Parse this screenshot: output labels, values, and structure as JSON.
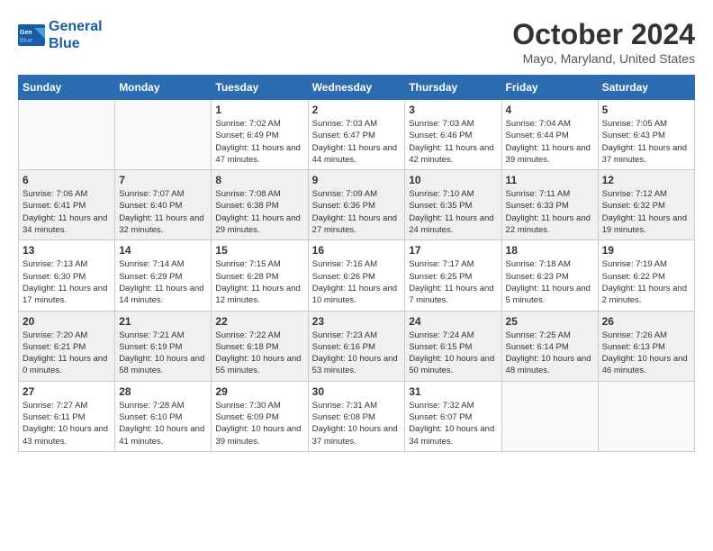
{
  "header": {
    "logo_line1": "General",
    "logo_line2": "Blue",
    "month_title": "October 2024",
    "location": "Mayo, Maryland, United States"
  },
  "weekdays": [
    "Sunday",
    "Monday",
    "Tuesday",
    "Wednesday",
    "Thursday",
    "Friday",
    "Saturday"
  ],
  "weeks": [
    [
      {
        "day": "",
        "info": ""
      },
      {
        "day": "",
        "info": ""
      },
      {
        "day": "1",
        "info": "Sunrise: 7:02 AM\nSunset: 6:49 PM\nDaylight: 11 hours and 47 minutes."
      },
      {
        "day": "2",
        "info": "Sunrise: 7:03 AM\nSunset: 6:47 PM\nDaylight: 11 hours and 44 minutes."
      },
      {
        "day": "3",
        "info": "Sunrise: 7:03 AM\nSunset: 6:46 PM\nDaylight: 11 hours and 42 minutes."
      },
      {
        "day": "4",
        "info": "Sunrise: 7:04 AM\nSunset: 6:44 PM\nDaylight: 11 hours and 39 minutes."
      },
      {
        "day": "5",
        "info": "Sunrise: 7:05 AM\nSunset: 6:43 PM\nDaylight: 11 hours and 37 minutes."
      }
    ],
    [
      {
        "day": "6",
        "info": "Sunrise: 7:06 AM\nSunset: 6:41 PM\nDaylight: 11 hours and 34 minutes."
      },
      {
        "day": "7",
        "info": "Sunrise: 7:07 AM\nSunset: 6:40 PM\nDaylight: 11 hours and 32 minutes."
      },
      {
        "day": "8",
        "info": "Sunrise: 7:08 AM\nSunset: 6:38 PM\nDaylight: 11 hours and 29 minutes."
      },
      {
        "day": "9",
        "info": "Sunrise: 7:09 AM\nSunset: 6:36 PM\nDaylight: 11 hours and 27 minutes."
      },
      {
        "day": "10",
        "info": "Sunrise: 7:10 AM\nSunset: 6:35 PM\nDaylight: 11 hours and 24 minutes."
      },
      {
        "day": "11",
        "info": "Sunrise: 7:11 AM\nSunset: 6:33 PM\nDaylight: 11 hours and 22 minutes."
      },
      {
        "day": "12",
        "info": "Sunrise: 7:12 AM\nSunset: 6:32 PM\nDaylight: 11 hours and 19 minutes."
      }
    ],
    [
      {
        "day": "13",
        "info": "Sunrise: 7:13 AM\nSunset: 6:30 PM\nDaylight: 11 hours and 17 minutes."
      },
      {
        "day": "14",
        "info": "Sunrise: 7:14 AM\nSunset: 6:29 PM\nDaylight: 11 hours and 14 minutes."
      },
      {
        "day": "15",
        "info": "Sunrise: 7:15 AM\nSunset: 6:28 PM\nDaylight: 11 hours and 12 minutes."
      },
      {
        "day": "16",
        "info": "Sunrise: 7:16 AM\nSunset: 6:26 PM\nDaylight: 11 hours and 10 minutes."
      },
      {
        "day": "17",
        "info": "Sunrise: 7:17 AM\nSunset: 6:25 PM\nDaylight: 11 hours and 7 minutes."
      },
      {
        "day": "18",
        "info": "Sunrise: 7:18 AM\nSunset: 6:23 PM\nDaylight: 11 hours and 5 minutes."
      },
      {
        "day": "19",
        "info": "Sunrise: 7:19 AM\nSunset: 6:22 PM\nDaylight: 11 hours and 2 minutes."
      }
    ],
    [
      {
        "day": "20",
        "info": "Sunrise: 7:20 AM\nSunset: 6:21 PM\nDaylight: 11 hours and 0 minutes."
      },
      {
        "day": "21",
        "info": "Sunrise: 7:21 AM\nSunset: 6:19 PM\nDaylight: 10 hours and 58 minutes."
      },
      {
        "day": "22",
        "info": "Sunrise: 7:22 AM\nSunset: 6:18 PM\nDaylight: 10 hours and 55 minutes."
      },
      {
        "day": "23",
        "info": "Sunrise: 7:23 AM\nSunset: 6:16 PM\nDaylight: 10 hours and 53 minutes."
      },
      {
        "day": "24",
        "info": "Sunrise: 7:24 AM\nSunset: 6:15 PM\nDaylight: 10 hours and 50 minutes."
      },
      {
        "day": "25",
        "info": "Sunrise: 7:25 AM\nSunset: 6:14 PM\nDaylight: 10 hours and 48 minutes."
      },
      {
        "day": "26",
        "info": "Sunrise: 7:26 AM\nSunset: 6:13 PM\nDaylight: 10 hours and 46 minutes."
      }
    ],
    [
      {
        "day": "27",
        "info": "Sunrise: 7:27 AM\nSunset: 6:11 PM\nDaylight: 10 hours and 43 minutes."
      },
      {
        "day": "28",
        "info": "Sunrise: 7:28 AM\nSunset: 6:10 PM\nDaylight: 10 hours and 41 minutes."
      },
      {
        "day": "29",
        "info": "Sunrise: 7:30 AM\nSunset: 6:09 PM\nDaylight: 10 hours and 39 minutes."
      },
      {
        "day": "30",
        "info": "Sunrise: 7:31 AM\nSunset: 6:08 PM\nDaylight: 10 hours and 37 minutes."
      },
      {
        "day": "31",
        "info": "Sunrise: 7:32 AM\nSunset: 6:07 PM\nDaylight: 10 hours and 34 minutes."
      },
      {
        "day": "",
        "info": ""
      },
      {
        "day": "",
        "info": ""
      }
    ]
  ]
}
